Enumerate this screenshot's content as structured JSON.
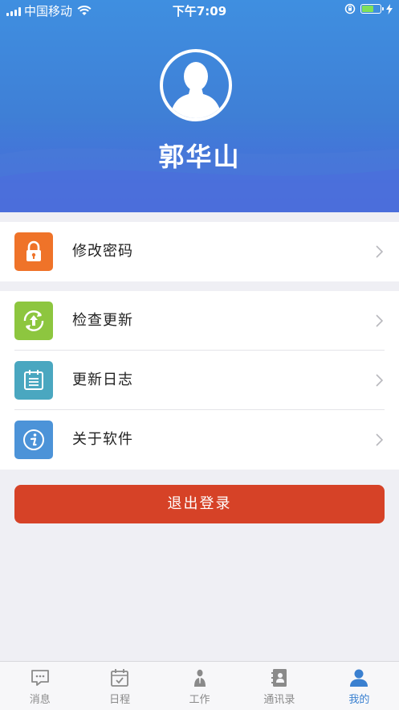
{
  "status_bar": {
    "carrier": "中国移动",
    "time": "下午7:09",
    "battery_level": 0.58
  },
  "profile": {
    "name": "郭华山"
  },
  "menu": {
    "change_password": "修改密码",
    "check_update": "检查更新",
    "update_log": "更新日志",
    "about": "关于软件"
  },
  "logout_label": "退出登录",
  "tabs": [
    {
      "label": "消息",
      "icon": "message-icon"
    },
    {
      "label": "日程",
      "icon": "calendar-icon"
    },
    {
      "label": "工作",
      "icon": "work-icon"
    },
    {
      "label": "通讯录",
      "icon": "contacts-icon"
    },
    {
      "label": "我的",
      "icon": "person-icon",
      "active": true
    }
  ],
  "colors": {
    "header_top": "#3f8fe0",
    "header_bottom": "#4a66dc",
    "lock_orange": "#ef7329",
    "update_green": "#8dc63f",
    "log_teal": "#4aa7c0",
    "about_blue": "#4c93d8",
    "logout_red": "#d64227",
    "active_tab": "#3a80d0"
  }
}
